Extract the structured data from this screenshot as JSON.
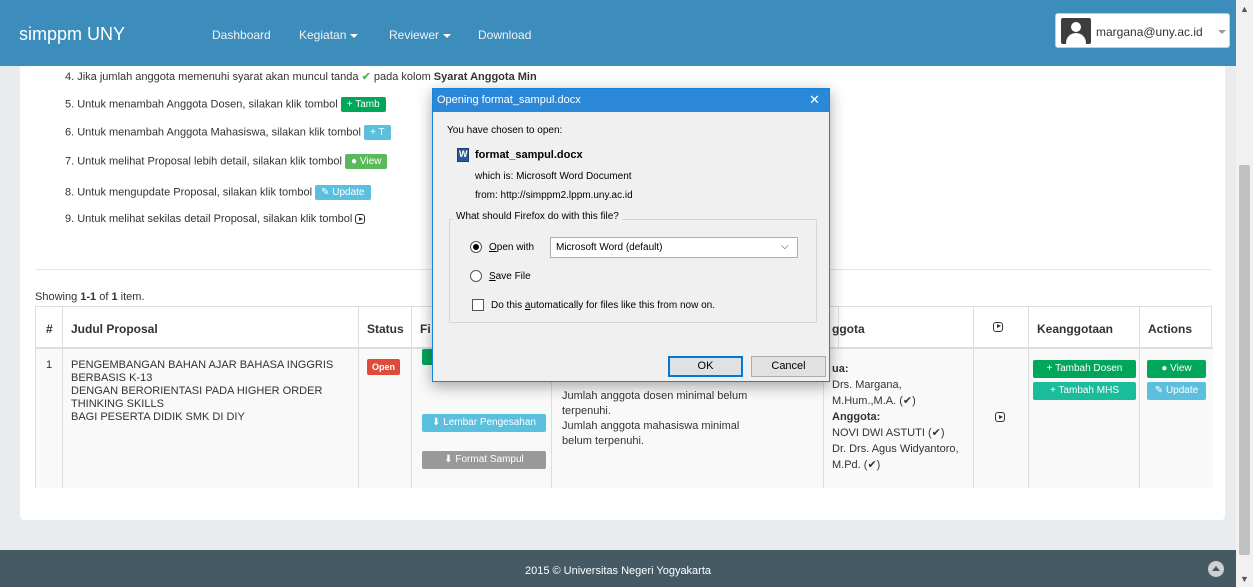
{
  "navbar": {
    "brand": "simppm UNY",
    "links": [
      "Dashboard",
      "Kegiatan",
      "Reviewer",
      "Download"
    ],
    "user_email": "margana@uny.ac.id"
  },
  "instructions": {
    "i4_text": "4. Jika jumlah anggota memenuhi syarat akan muncul tanda",
    "i4_mid": "pada kolom",
    "i4_bold": "Syarat Anggota Min",
    "i5_text": "5. Untuk menambah Anggota Dosen, silakan klik tombol",
    "i5_btn": "+ Tamb",
    "i6_text": "6. Untuk menambah Anggota Mahasiswa, silakan klik tombol",
    "i6_btn": "+ T",
    "i7_text": "7. Untuk melihat Proposal lebih detail, silakan klik tombol",
    "i7_btn": "● View",
    "i8_text": "8. Untuk mengupdate Proposal, silakan klik tombol",
    "i8_btn": "✎ Update",
    "i9_text": "9. Untuk melihat sekilas detail Proposal, silakan klik tombol"
  },
  "summary": {
    "prefix": "Showing",
    "range": "1-1",
    "of": "of",
    "total": "1",
    "suffix": "item."
  },
  "table": {
    "headers": {
      "num": "#",
      "judul": "Judul Proposal",
      "status": "Status",
      "file": "Fi",
      "anggota": "ggota",
      "keanggotaan": "Keanggotaan",
      "actions": "Actions"
    },
    "row": {
      "num": "1",
      "judul": [
        "PENGEMBANGAN BAHAN AJAR BAHASA INGGRIS",
        "BERBASIS K-13",
        "DENGAN BERORIENTASI PADA HIGHER ORDER",
        "THINKING SKILLS",
        "BAGI PESERTA DIDIK SMK DI DIY"
      ],
      "status": "Open",
      "file_buttons": [
        "⬇ Lembar Pengesahan",
        "⬇ Format Sampul"
      ],
      "syarat": [
        "Jumlah anggota dosen minimal belum",
        "terpenuhi.",
        "Jumlah anggota mahasiswa minimal",
        "belum terpenuhi."
      ],
      "ketua_label": "ua:",
      "ketua_name_1": "Drs. Margana,",
      "ketua_name_2": "M.Hum.,M.A. (✔)",
      "anggota_label": "Anggota:",
      "anggota_1": "NOVI DWI ASTUTI (✔)",
      "anggota_2a": "Dr. Drs. Agus Widyantoro,",
      "anggota_2b": "M.Pd. (✔)",
      "keanggotaan_buttons": [
        "+ Tambah Dosen",
        "+ Tambah MHS"
      ],
      "action_buttons": [
        "● View",
        "✎ Update"
      ]
    }
  },
  "dialog": {
    "title": "Opening format_sampul.docx",
    "intro": "You have chosen to open:",
    "filename": "format_sampul.docx",
    "which_is": "which is:  Microsoft Word Document",
    "from": "from:  http://simppm2.lppm.uny.ac.id",
    "question": "What should Firefox do with this file?",
    "open_with_prefix": "O",
    "open_with_rest": "pen with",
    "app": "Microsoft Word (default)",
    "save_prefix": "S",
    "save_rest": "ave File",
    "auto_pre": "Do this ",
    "auto_u": "a",
    "auto_rest": "utomatically for files like this from now on.",
    "ok": "OK",
    "cancel": "Cancel"
  },
  "footer": {
    "text": "2015 © Universitas Negeri Yogyakarta"
  },
  "colors": {
    "navbar": "#3c8dbc",
    "footer": "#455a64",
    "open_badge": "#dd4b39",
    "success": "#00a65a",
    "info": "#5bc0de"
  }
}
